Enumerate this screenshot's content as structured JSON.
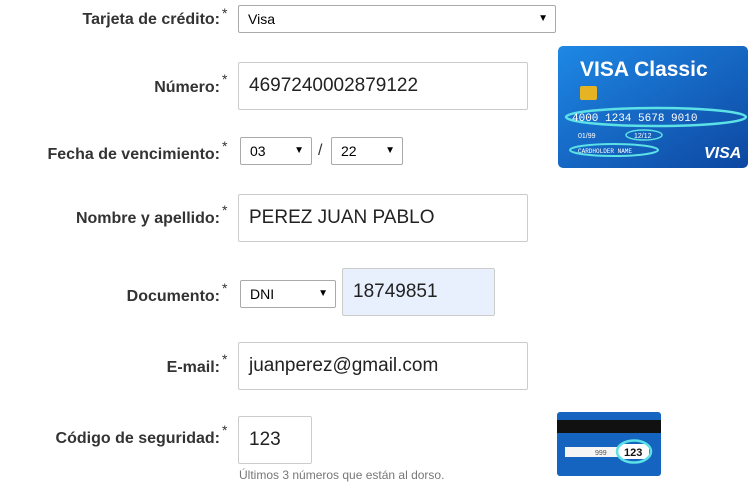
{
  "form": {
    "card_type": {
      "label": "Tarjeta de crédito:",
      "required": "*",
      "value": "Visa"
    },
    "number": {
      "label": "Número:",
      "required": "*",
      "value": "4697240002879122"
    },
    "expiry": {
      "label": "Fecha de vencimiento:",
      "required": "*",
      "month": "03",
      "separator": "/",
      "year": "22"
    },
    "name": {
      "label": "Nombre y apellido:",
      "required": "*",
      "value": "PEREZ JUAN PABLO"
    },
    "document": {
      "label": "Documento:",
      "required": "*",
      "type": "DNI",
      "value": "18749851"
    },
    "email": {
      "label": "E-mail:",
      "required": "*",
      "value": "juanperez@gmail.com"
    },
    "security": {
      "label": "Código de seguridad:",
      "required": "*",
      "value": "123",
      "hint": "Últimos 3 números que están al dorso."
    }
  },
  "visa_card": {
    "title": "VISA Classic",
    "number": "4000 1234 5678 9010",
    "valid_from": "01/99",
    "valid_thru": "12/12",
    "holder": "CARDHOLDER NAME",
    "brand": "VISA"
  },
  "cvv_card": {
    "strip_number": "999",
    "cvv": "123"
  },
  "colors": {
    "doc_input_bg": "#e8f0fe",
    "card_blue": "#1565c0",
    "highlight": "#5ce1e6"
  }
}
